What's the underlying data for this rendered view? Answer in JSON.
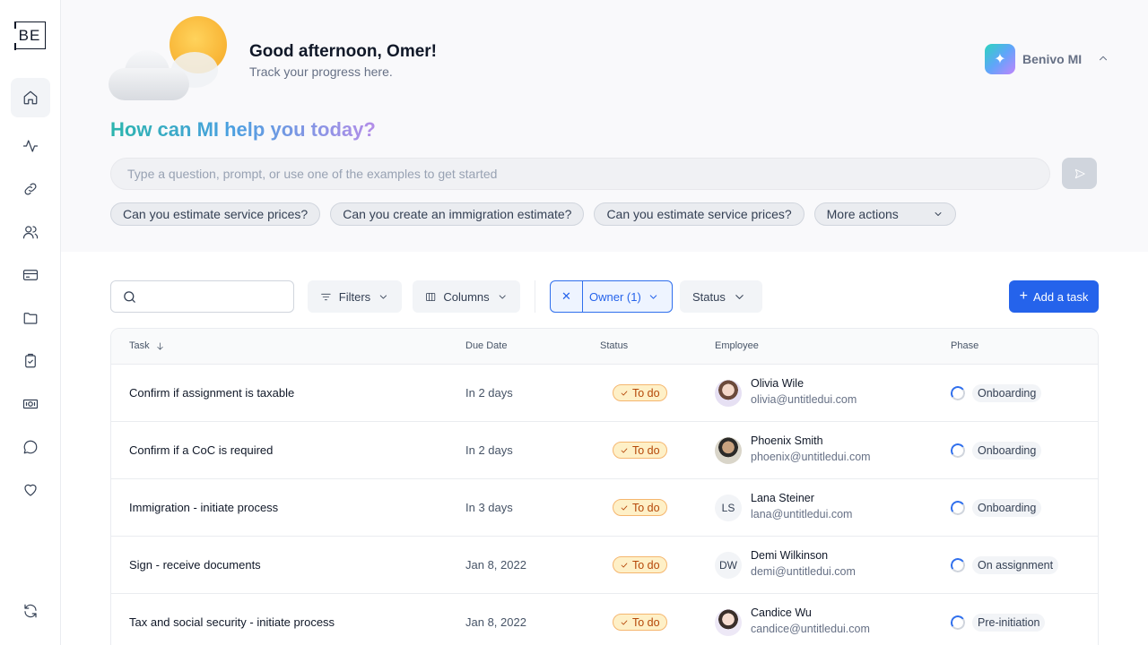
{
  "sidebar": {
    "logo": "BE",
    "items": [
      {
        "icon": "home-icon"
      },
      {
        "icon": "activity-icon"
      },
      {
        "icon": "link-icon"
      },
      {
        "icon": "users-icon"
      },
      {
        "icon": "credit-card-icon"
      },
      {
        "icon": "folder-icon"
      },
      {
        "icon": "clipboard-check-icon"
      },
      {
        "icon": "money-icon"
      },
      {
        "icon": "message-icon"
      },
      {
        "icon": "heart-icon"
      },
      {
        "icon": "refresh-icon"
      }
    ]
  },
  "header": {
    "greeting": "Good afternoon, Omer!",
    "subtitle": "Track your progress here.",
    "assistant_name": "Benivo MI"
  },
  "assistant": {
    "title": "How can MI help you today?",
    "placeholder": "Type a question, prompt, or use one of the examples to get started",
    "chips": [
      "Can you estimate service prices?",
      "Can you create an immigration estimate?",
      "Can you estimate service prices?"
    ],
    "more_actions": "More actions"
  },
  "toolbar": {
    "filters_label": "Filters",
    "columns_label": "Columns",
    "owner_filter_label": "Owner (1)",
    "status_label": "Status",
    "add_task_label": "Add a task"
  },
  "table": {
    "headers": {
      "task": "Task",
      "due_date": "Due Date",
      "status": "Status",
      "employee": "Employee",
      "phase": "Phase"
    },
    "rows": [
      {
        "task": "Confirm if assignment is taxable",
        "due": "In 2 days",
        "status": "To do",
        "name": "Olivia Wile",
        "email": "olivia@untitledui.com",
        "initials": "",
        "phase": "Onboarding"
      },
      {
        "task": "Confirm if a CoC is required",
        "due": "In 2 days",
        "status": "To do",
        "name": "Phoenix Smith",
        "email": "phoenix@untitledui.com",
        "initials": "",
        "phase": "Onboarding"
      },
      {
        "task": "Immigration - initiate process",
        "due": "In 3 days",
        "status": "To do",
        "name": "Lana Steiner",
        "email": "lana@untitledui.com",
        "initials": "LS",
        "phase": "Onboarding"
      },
      {
        "task": "Sign - receive documents",
        "due": "Jan 8, 2022",
        "status": "To do",
        "name": "Demi Wilkinson",
        "email": "demi@untitledui.com",
        "initials": "DW",
        "phase": "On assignment"
      },
      {
        "task": "Tax and social security - initiate process",
        "due": "Jan 8, 2022",
        "status": "To do",
        "name": "Candice Wu",
        "email": "candice@untitledui.com",
        "initials": "",
        "phase": "Pre-initiation"
      }
    ]
  },
  "colors": {
    "primary": "#2563eb",
    "status_todo_bg": "#fef0c7",
    "status_todo_text": "#b54708"
  }
}
